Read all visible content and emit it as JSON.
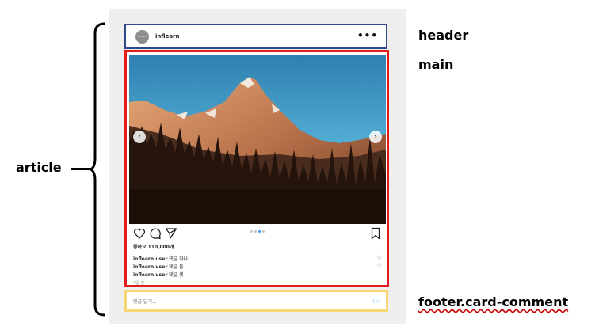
{
  "labels": {
    "article": "article",
    "header": "header",
    "main": "main",
    "footer": "footer.card-comment"
  },
  "card": {
    "avatar_text": "inflearn",
    "username": "inflearn",
    "more": "•••",
    "nav_prev": "‹",
    "nav_next": "›",
    "likes": "좋아요 110,000개",
    "comments": [
      {
        "user": "inflearn.user",
        "text": " 댓글 하나",
        "heart": "♡"
      },
      {
        "user": "inflearn.user",
        "text": " 댓글 둘",
        "heart": "♡"
      },
      {
        "user": "inflearn.user",
        "text": " 댓글 셋",
        "heart": "♡"
      }
    ],
    "time": "7일 전",
    "carousel_dots": 4,
    "carousel_active": 2
  },
  "footer": {
    "placeholder": "댓글 달기...",
    "post_label": "게시"
  },
  "colors": {
    "header_border": "#2e4a8a",
    "main_border": "#e21b1b",
    "footer_border": "#f7d676",
    "panel": "#efefef"
  },
  "icons": [
    "heart-icon",
    "comment-icon",
    "share-icon",
    "bookmark-icon",
    "more-icon"
  ]
}
